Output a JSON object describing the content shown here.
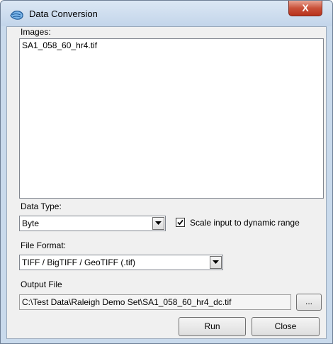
{
  "window": {
    "title": "Data Conversion",
    "close_glyph": "X"
  },
  "images": {
    "label": "Images:",
    "items": [
      "SA1_058_60_hr4.tif"
    ]
  },
  "data_type": {
    "label": "Data Type:",
    "value": "Byte"
  },
  "scale_input": {
    "label": "Scale input to dynamic range",
    "checked": true
  },
  "file_format": {
    "label": "File Format:",
    "value": "TIFF / BigTIFF / GeoTIFF (.tif)"
  },
  "output_file": {
    "label": "Output File",
    "value": "C:\\Test Data\\Raleigh Demo Set\\SA1_058_60_hr4_dc.tif",
    "browse_label": "..."
  },
  "buttons": {
    "run": "Run",
    "close": "Close"
  }
}
